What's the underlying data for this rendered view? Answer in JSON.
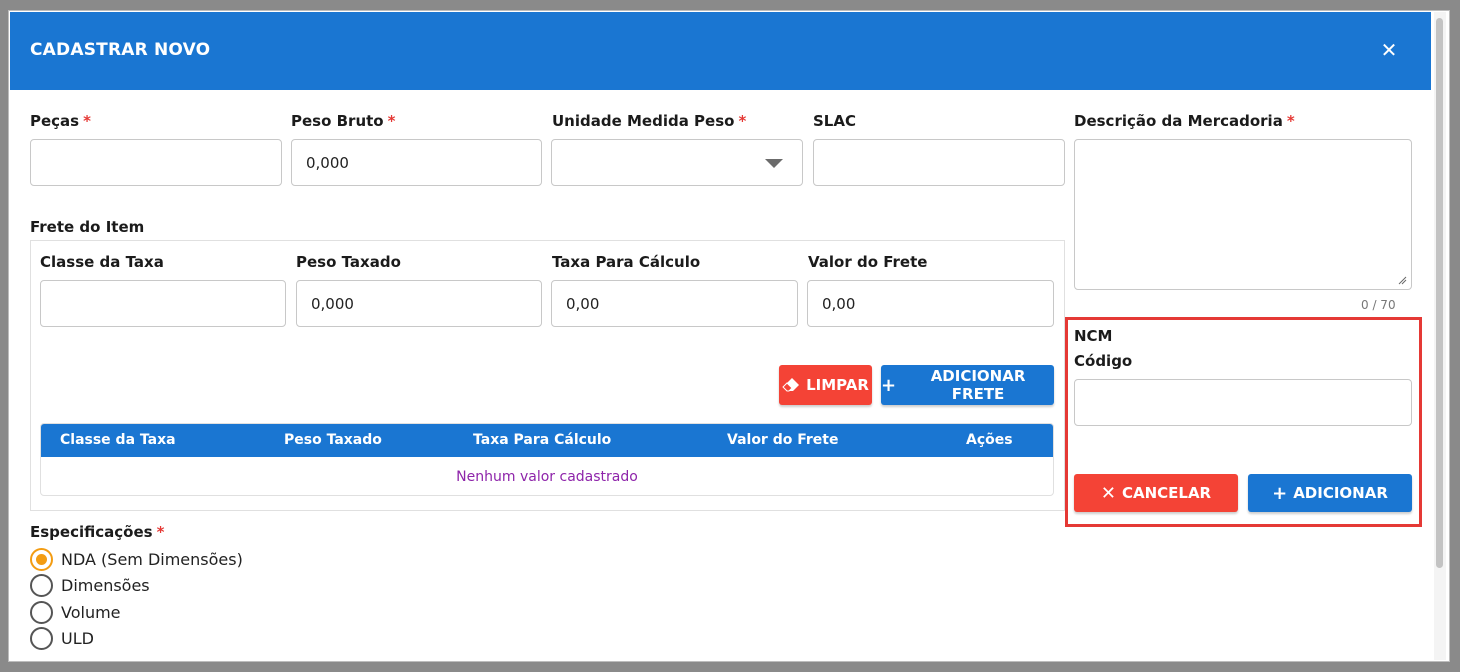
{
  "modal": {
    "title": "CADASTRAR NOVO",
    "close_label": "✕"
  },
  "form": {
    "pecas": {
      "label": "Peças",
      "required": "*",
      "value": ""
    },
    "peso_bruto": {
      "label": "Peso Bruto",
      "required": "*",
      "value": "0,000"
    },
    "unidade_medida_peso": {
      "label": "Unidade Medida Peso",
      "required": "*",
      "selected": ""
    },
    "slac": {
      "label": "SLAC",
      "value": ""
    },
    "descricao": {
      "label": "Descrição da Mercadoria",
      "required": "*",
      "value": "",
      "counter": "0 / 70"
    }
  },
  "frete": {
    "section_label": "Frete do Item",
    "classe_taxa": {
      "label": "Classe da Taxa",
      "value": ""
    },
    "peso_taxado": {
      "label": "Peso Taxado",
      "value": "0,000"
    },
    "taxa_calculo": {
      "label": "Taxa Para Cálculo",
      "value": "0,00"
    },
    "valor_frete": {
      "label": "Valor do Frete",
      "value": "0,00"
    },
    "limpar_label": "LIMPAR",
    "adicionar_frete_label": "ADICIONAR FRETE",
    "table": {
      "headers": [
        "Classe da Taxa",
        "Peso Taxado",
        "Taxa Para Cálculo",
        "Valor do Frete",
        "Ações"
      ],
      "empty_message": "Nenhum valor cadastrado"
    }
  },
  "especificacoes": {
    "label": "Especificações",
    "required": "*",
    "options": [
      {
        "label": "NDA (Sem Dimensões)",
        "checked": true
      },
      {
        "label": "Dimensões",
        "checked": false
      },
      {
        "label": "Volume",
        "checked": false
      },
      {
        "label": "ULD",
        "checked": false
      }
    ]
  },
  "ncm": {
    "title": "NCM",
    "codigo_label": "Código",
    "codigo_value": "",
    "cancelar_label": "CANCELAR",
    "adicionar_label": "ADICIONAR"
  },
  "colors": {
    "primary": "#1a76d2",
    "danger": "#f44336",
    "radio_accent": "#f39c12",
    "highlight": "#e53935",
    "empty_text": "#8e24aa"
  }
}
